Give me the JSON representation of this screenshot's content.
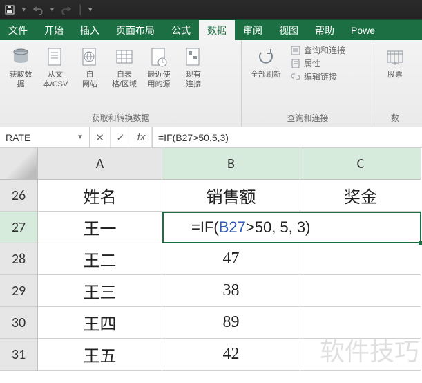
{
  "titlebar": {
    "save": "save-icon",
    "undo": "undo-icon",
    "redo": "redo-icon"
  },
  "tabs": {
    "file": "文件",
    "home": "开始",
    "insert": "插入",
    "layout": "页面布局",
    "formulas": "公式",
    "data": "数据",
    "review": "审阅",
    "view": "视图",
    "help": "帮助",
    "power": "Powe"
  },
  "ribbon": {
    "group1_label": "获取和转换数据",
    "btn_getdata": "获取数\n据",
    "btn_csv": "从文\n本/CSV",
    "btn_web": "自\n网站",
    "btn_table": "自表\n格/区域",
    "btn_recent": "最近使\n用的源",
    "btn_conn": "现有\n连接",
    "group2_label": "查询和连接",
    "btn_refresh": "全部刷新",
    "mini_queries": "查询和连接",
    "mini_props": "属性",
    "mini_links": "编辑链接",
    "group3_label": "数",
    "btn_stocks": "股票"
  },
  "fx": {
    "namebox": "RATE",
    "formula": "=IF(B27>50,5,3)"
  },
  "grid": {
    "cols": {
      "A": "A",
      "B": "B",
      "C": "C"
    },
    "rows": {
      "r26": "26",
      "r27": "27",
      "r28": "28",
      "r29": "29",
      "r30": "30",
      "r31": "31"
    },
    "header": {
      "name": "姓名",
      "sales": "销售额",
      "bonus": "奖金"
    },
    "formula_parts": {
      "pre": "=IF(",
      "ref": "B27",
      "post": ">50, 5, 3)"
    },
    "data": {
      "a27": "王一",
      "a28": "王二",
      "a29": "王三",
      "a30": "王四",
      "a31": "王五",
      "b28": "47",
      "b29": "38",
      "b30": "89",
      "b31": "42"
    }
  },
  "chart_data": {
    "type": "table",
    "columns": [
      "姓名",
      "销售额",
      "奖金"
    ],
    "rows": [
      {
        "姓名": "王一",
        "销售额": null,
        "奖金": null
      },
      {
        "姓名": "王二",
        "销售额": 47,
        "奖金": null
      },
      {
        "姓名": "王三",
        "销售额": 38,
        "奖金": null
      },
      {
        "姓名": "王四",
        "销售额": 89,
        "奖金": null
      },
      {
        "姓名": "王五",
        "销售额": 42,
        "奖金": null
      }
    ],
    "active_cell": "B27",
    "active_formula": "=IF(B27>50,5,3)"
  },
  "watermark": "软件技巧"
}
